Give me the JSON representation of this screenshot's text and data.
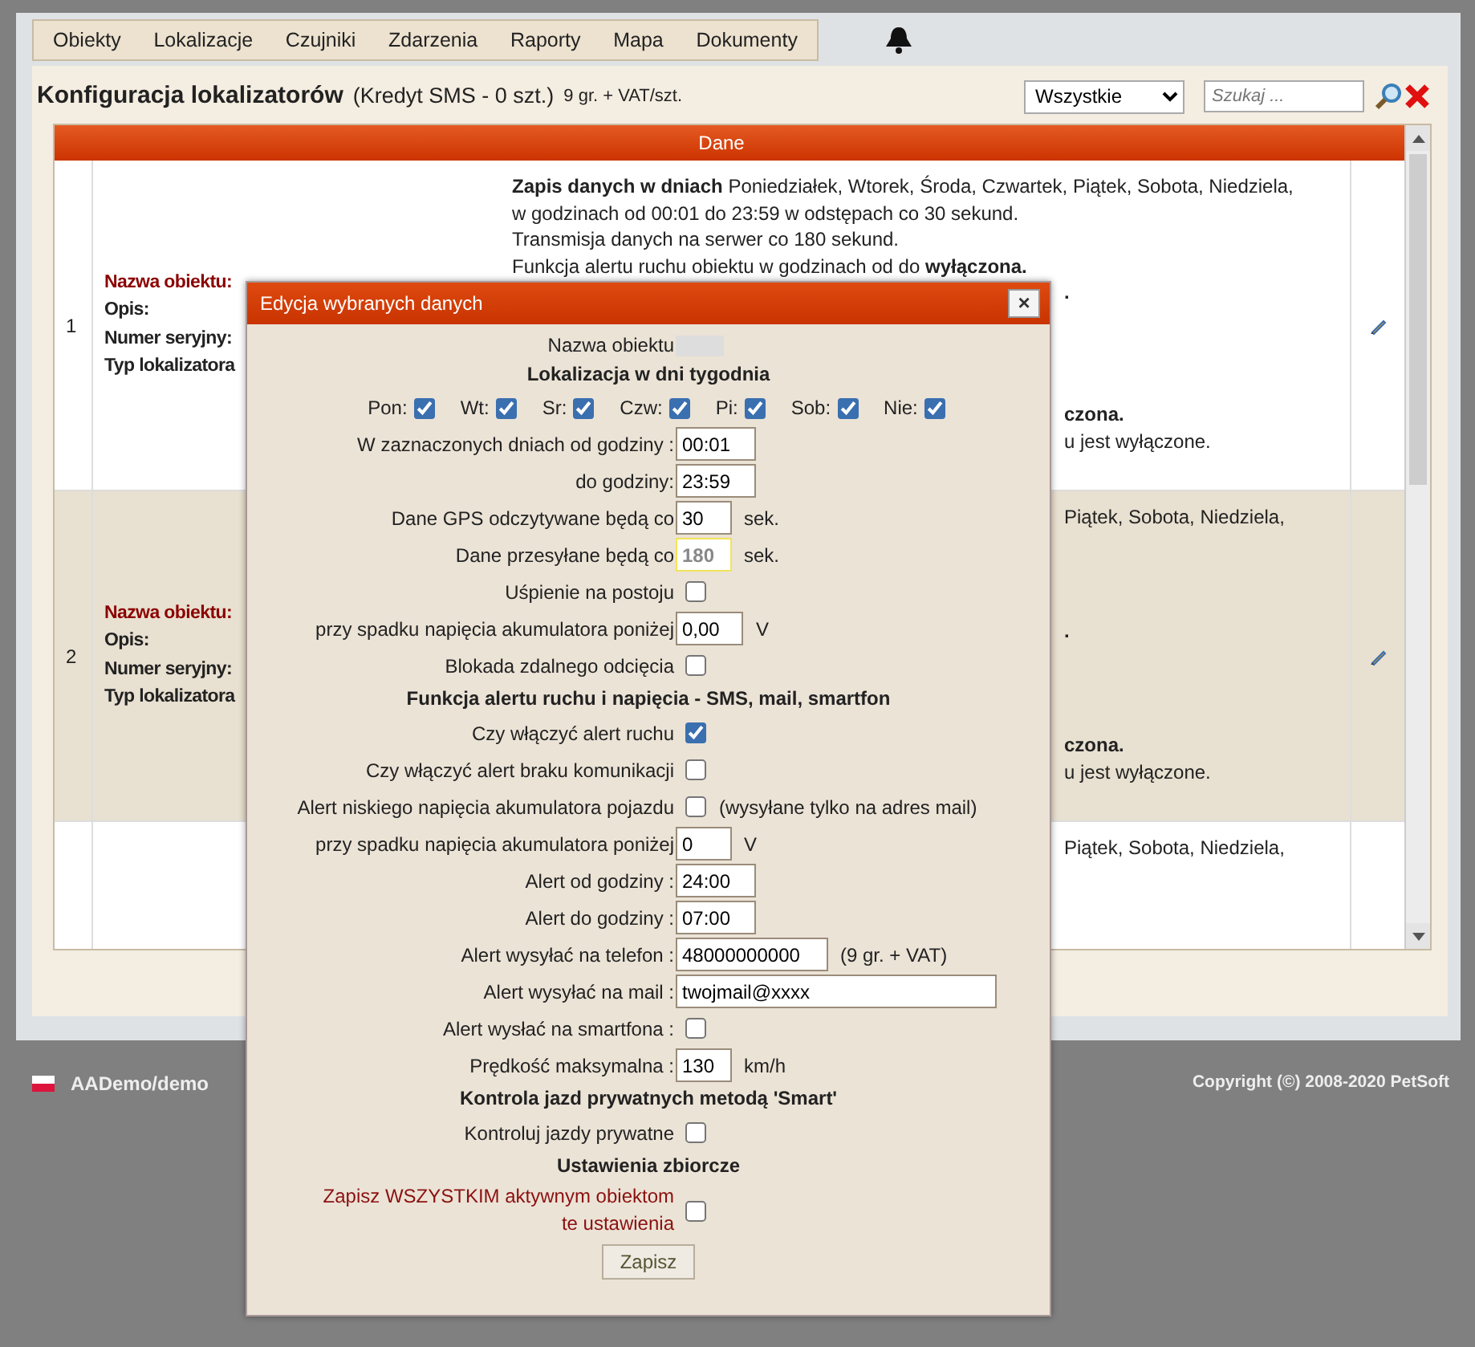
{
  "nav": {
    "items": [
      "Obiekty",
      "Lokalizacje",
      "Czujniki",
      "Zdarzenia",
      "Raporty",
      "Mapa",
      "Dokumenty"
    ]
  },
  "header": {
    "title": "Konfiguracja lokalizatorów",
    "credit": "(Kredyt SMS - 0 szt.)",
    "price": "9 gr. + VAT/szt.",
    "filter": "Wszystkie",
    "search": {
      "placeholder": "Szukaj ..."
    }
  },
  "table": {
    "columns": [
      "Dane"
    ],
    "rows": [
      {
        "number": "1",
        "selected": false,
        "labels": [
          "Nazwa obiektu:",
          "Opis:",
          "Numer seryjny:",
          "Typ lokalizatora"
        ],
        "lines": [
          "**Zapis danych w dniach** Poniedziałek, Wtorek, Środa, Czwartek, Piątek, Sobota, Niedziela,",
          "w godzinach od 00:01 do 23:59 w odstępach co 30 sekund.",
          "Transmisja danych na serwer co 180 sekund.",
          "Funkcja alertu ruchu obiektu w godzinach od do **wyłączona.**"
        ],
        "fragments": [
          [
            "**.**"
          ],
          [
            "**czona.**",
            "u jest wyłączone."
          ]
        ]
      },
      {
        "number": "2",
        "selected": true,
        "labels": [
          "Nazwa obiektu:",
          "Opis:",
          "Numer seryjny:",
          "Typ lokalizatora"
        ],
        "lines": [],
        "fragments": [
          [
            "Piątek, Sobota, Niedziela,"
          ],
          [
            "**.**"
          ],
          [
            "**czona.**",
            "u jest wyłączone."
          ]
        ]
      },
      {
        "number": "",
        "selected": false,
        "labels": [],
        "lines": [],
        "fragments": [
          [
            "Piątek, Sobota, Niedziela,"
          ]
        ]
      }
    ]
  },
  "footer": {
    "user": "AADemo/demo",
    "copyright": "Copyright (©) 2008-2020 PetSoft"
  },
  "dialog": {
    "title": "Edycja wybranych danych",
    "close": "×",
    "button": "Zapisz",
    "fields": [
      {
        "kind": "name",
        "label": "Nazwa obiektu"
      },
      {
        "kind": "heading",
        "label": "Lokalizacja w dni tygodnia"
      },
      {
        "kind": "days",
        "days": [
          {
            "label": "Pon:",
            "checked": true
          },
          {
            "label": "Wt:",
            "checked": true
          },
          {
            "label": "Sr:",
            "checked": true
          },
          {
            "label": "Czw:",
            "checked": true
          },
          {
            "label": "Pi:",
            "checked": true
          },
          {
            "label": "Sob:",
            "checked": true
          },
          {
            "label": "Nie:",
            "checked": true
          }
        ]
      },
      {
        "kind": "input",
        "label": "W zaznaczonych dniach od godziny :",
        "value": "00:01",
        "disabled": false
      },
      {
        "kind": "input",
        "label": "do godziny:",
        "value": "23:59",
        "disabled": false
      },
      {
        "kind": "input",
        "label": "Dane GPS odczytywane będą co",
        "value": "30",
        "unit": "sek.",
        "disabled": false
      },
      {
        "kind": "input",
        "label": "Dane przesyłane będą co",
        "value": "180",
        "unit": "sek.",
        "disabled": true
      },
      {
        "kind": "checkbox",
        "label": "Uśpienie na postoju",
        "checked": false
      },
      {
        "kind": "input",
        "label": "przy spadku napięcia akumulatora poniżej",
        "value": "0,00",
        "unit": "V",
        "disabled": false
      },
      {
        "kind": "checkbox",
        "label": "Blokada zdalnego odcięcia",
        "checked": false
      },
      {
        "kind": "heading",
        "label": "Funkcja alertu ruchu i napięcia - SMS, mail, smartfon"
      },
      {
        "kind": "checkbox",
        "label": "Czy włączyć alert ruchu",
        "checked": true
      },
      {
        "kind": "checkbox",
        "label": "Czy włączyć alert braku komunikacji",
        "checked": false
      },
      {
        "kind": "checkbox",
        "label": "Alert niskiego napięcia akumulatora pojazdu",
        "checked": false,
        "note": "(wysyłane tylko na adres mail)"
      },
      {
        "kind": "input",
        "label": "przy spadku napięcia akumulatora poniżej",
        "value": "0",
        "unit": "V",
        "disabled": false
      },
      {
        "kind": "input",
        "label": "Alert od godziny :",
        "value": "24:00",
        "disabled": false
      },
      {
        "kind": "input",
        "label": "Alert do godziny :",
        "value": "07:00",
        "disabled": false
      },
      {
        "kind": "input",
        "label": "Alert wysyłać na telefon :",
        "value": "48000000000",
        "unit": "(9 gr. + VAT)",
        "disabled": false
      },
      {
        "kind": "wide-input",
        "label": "Alert wysyłać na mail :",
        "value": "twojmail@xxxx",
        "disabled": false
      },
      {
        "kind": "checkbox",
        "label": "Alert wysłać na smartfona :",
        "checked": false
      },
      {
        "kind": "input",
        "label": "Prędkość maksymalna :",
        "value": "130",
        "unit": "km/h",
        "disabled": false
      },
      {
        "kind": "heading",
        "label": "Kontrola jazd prywatnych metodą 'Smart'"
      },
      {
        "kind": "checkbox",
        "label": "Kontroluj jazdy prywatne",
        "checked": false
      },
      {
        "kind": "heading",
        "label": "Ustawienia zbiorcze"
      },
      {
        "kind": "danger-checkbox",
        "label": "Zapisz WSZYSTKIM aktywnym obiektom te ustawienia",
        "checked": false
      }
    ]
  }
}
